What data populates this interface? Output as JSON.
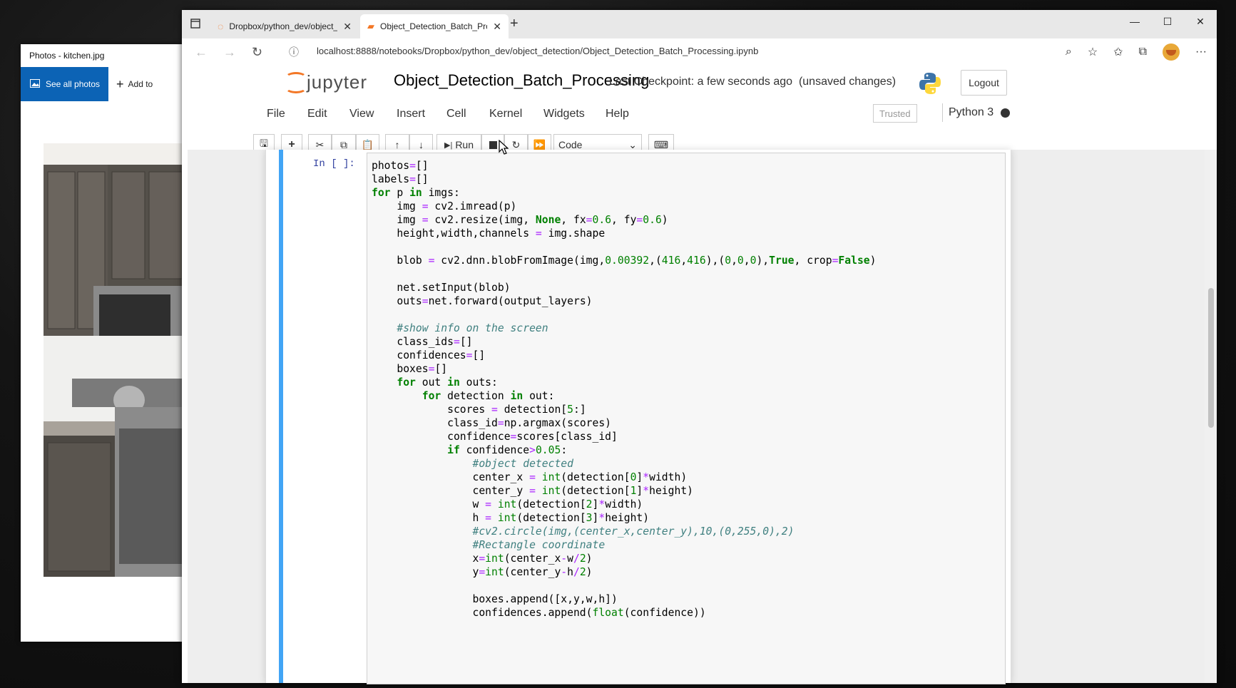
{
  "photos_window": {
    "title": "Photos - kitchen.jpg",
    "see_all": "See all photos",
    "add_to": "Add to"
  },
  "browser": {
    "tabs": [
      {
        "label": "Dropbox/python_dev/object_det"
      },
      {
        "label": "Object_Detection_Batch_Process"
      }
    ],
    "url": "localhost:8888/notebooks/Dropbox/python_dev/object_detection/Object_Detection_Batch_Processing.ipynb"
  },
  "jupyter": {
    "logo_text": "jupyter",
    "notebook_name": "Object_Detection_Batch_Processing",
    "checkpoint": "Last Checkpoint: a few seconds ago  (unsaved changes)",
    "logout": "Logout",
    "menus": [
      "File",
      "Edit",
      "View",
      "Insert",
      "Cell",
      "Kernel",
      "Widgets",
      "Help"
    ],
    "trusted": "Trusted",
    "kernel_name": "Python 3",
    "run_label": "Run",
    "cell_type": "Code",
    "cell_prompt": "In [ ]:"
  }
}
